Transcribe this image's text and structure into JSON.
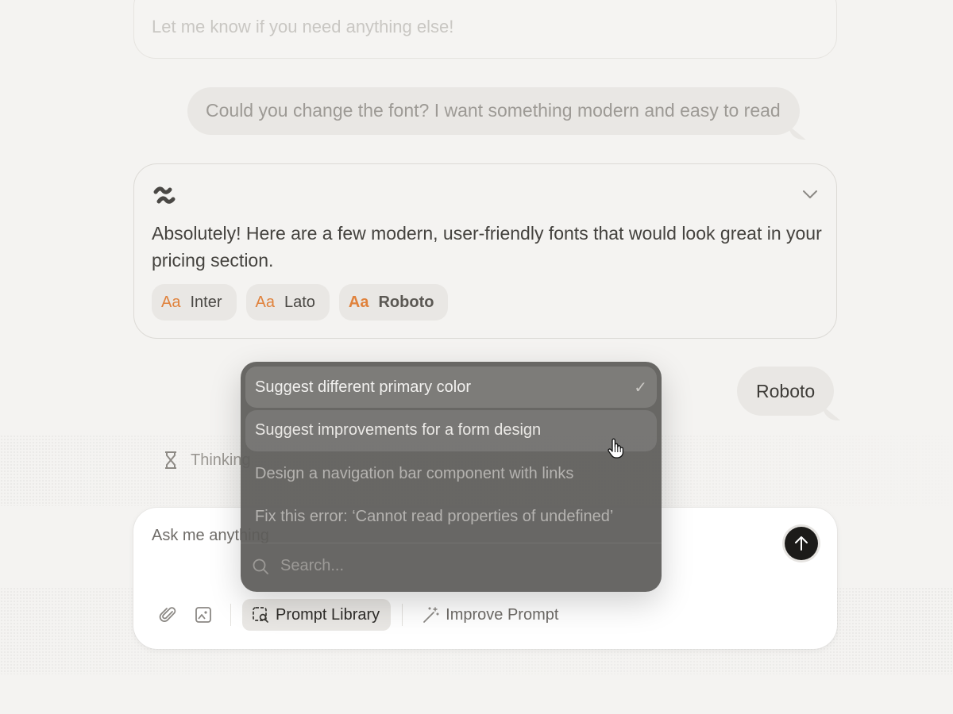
{
  "chat": {
    "previous_assistant_text": "Let me know if you need anything else!",
    "user_message_1": "Could you change the font? I want something modern and easy to read",
    "assistant": {
      "message": "Absolutely! Here are a few modern, user-friendly fonts that would look great in your pricing section.",
      "font_chips": [
        {
          "prefix": "Aa",
          "name": "Inter"
        },
        {
          "prefix": "Aa",
          "name": "Lato"
        },
        {
          "prefix": "Aa",
          "name": "Roboto"
        }
      ]
    },
    "user_message_2": "Roboto",
    "thinking_label": "Thinking"
  },
  "composer": {
    "placeholder": "Ask me anything",
    "prompt_library_label": "Prompt Library",
    "improve_prompt_label": "Improve Prompt"
  },
  "prompt_dropdown": {
    "items": [
      {
        "label": "Suggest different primary color",
        "selected": true
      },
      {
        "label": "Suggest improvements for a form design",
        "hovered": true
      },
      {
        "label": "Design a navigation bar component with links"
      },
      {
        "label": "Fix this error: ‘Cannot read properties of undefined’"
      }
    ],
    "search_placeholder": "Search..."
  },
  "colors": {
    "background": "#f4f3f1",
    "accent_orange": "#e0823c",
    "send_button": "#1c1b19",
    "dropdown_bg": "#5c5b59"
  },
  "icons": [
    "logo-icon",
    "chevron-down-icon",
    "hourglass-icon",
    "paperclip-icon",
    "image-icon",
    "prompt-library-icon",
    "magic-wand-icon",
    "arrow-up-icon",
    "search-icon",
    "check-icon",
    "hand-cursor-icon"
  ]
}
